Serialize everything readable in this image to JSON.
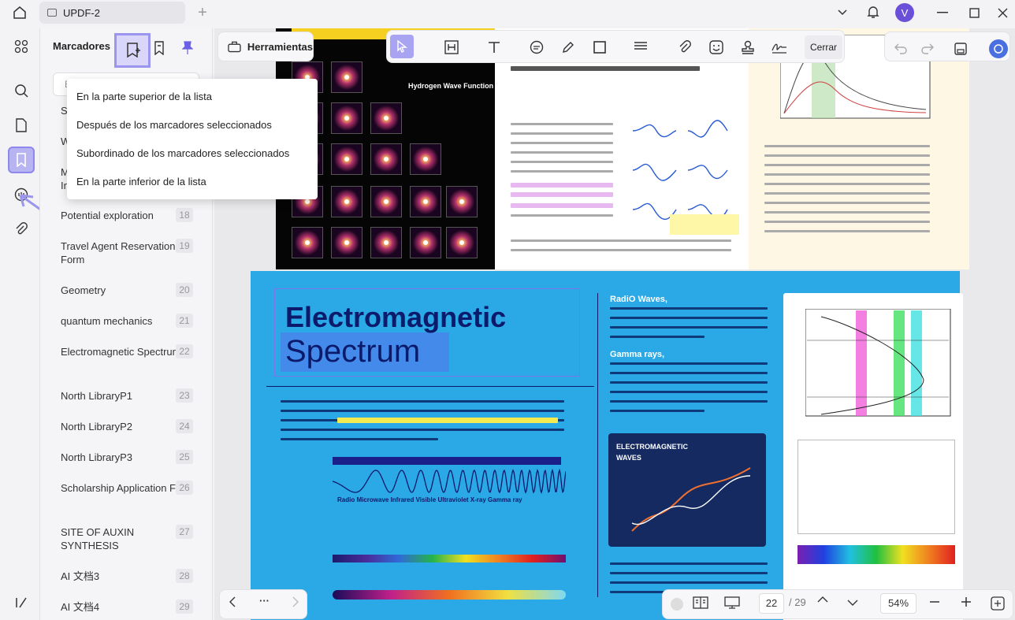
{
  "window": {
    "tab_title": "UPDF-2",
    "avatar_letter": "V"
  },
  "panel": {
    "title": "Marcadores",
    "search_placeholder": "Bu",
    "partial_items": [
      "Sl",
      "W",
      "M",
      "In"
    ],
    "items": [
      {
        "label": "Potential exploration",
        "num": "18"
      },
      {
        "label": "Travel Agent Reservation Form",
        "num": "19"
      },
      {
        "label": "Geometry",
        "num": "20"
      },
      {
        "label": "quantum mechanics",
        "num": "21"
      },
      {
        "label": "Electromagnetic Spectrum",
        "num": "22"
      },
      {
        "label": "North LibraryP1",
        "num": "23"
      },
      {
        "label": "North LibraryP2",
        "num": "24"
      },
      {
        "label": "North LibraryP3",
        "num": "25"
      },
      {
        "label": "Scholarship Application Form",
        "num": "26"
      },
      {
        "label": "SITE OF AUXIN SYNTHESIS",
        "num": "27"
      },
      {
        "label": "AI 文档3",
        "num": "28"
      },
      {
        "label": "AI 文档4",
        "num": "29"
      }
    ]
  },
  "menu": {
    "items": [
      "En la parte superior de la lista",
      "Después de los marcadores seleccionados",
      "Subordinado de los marcadores seleccionados",
      "En la parte inferior de la lista"
    ]
  },
  "toolbar": {
    "tools_label": "Herramientas",
    "close_label": "Cerrar"
  },
  "doc": {
    "p1_label": "Hydrogen Wave Function",
    "p2_title_line1": "Electromagnetic",
    "p2_title_line2": "Spectrum",
    "p2_radio_heading": "RadiO Waves,",
    "p2_gamma_heading": "Gamma rays,",
    "p2_em_box": "ELECTROMAGNETIC WAVES",
    "p2_radiation_types": "Radio   Microwave   Infrared Visible Ultraviolet X-ray Gamma ray"
  },
  "pagination": {
    "current_page": "22",
    "total": "/ 29",
    "zoom": "54%"
  },
  "colors": {
    "accent": "#8d87ee",
    "active_bg": "#b8b4f2",
    "page2_bg": "#2aa9e6"
  }
}
